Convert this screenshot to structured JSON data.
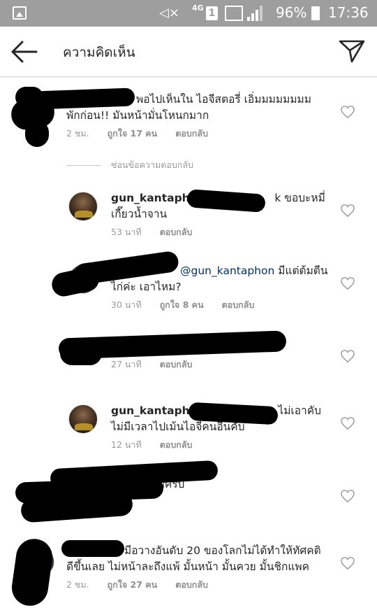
{
  "status_bar": {
    "network": "4G",
    "sim_slot": "1",
    "battery_percent": "96%",
    "time": "17:36"
  },
  "header": {
    "title": "ความคิดเห็น"
  },
  "hide_replies_label": "ซ่อนข้อความตอบกลับ",
  "comments": [
    {
      "text_line1": "พอไปเห็นใน ไอจีสตอรี่ เอิ่มมมมมมมม",
      "text_line2": "พักก่อน!! มันหน้ามั่นโหนกมาก",
      "time": "2 ชม.",
      "likes": "ถูกใจ 17 คน",
      "reply": "ตอบกลับ"
    },
    {
      "username": "gun_kantaphon",
      "text_line1": "k ขอบะหมี่",
      "text_line2": "เกี๊ยวน้ำจาน",
      "time": "53 นาที",
      "reply": "ตอบกลับ"
    },
    {
      "mention": "@gun_kantaphon",
      "text_line1": " มีแต่ต้มตีน",
      "text_line2": "ไก่ค่ะ เอาไหม?",
      "time": "30 นาที",
      "likes": "ถูกใจ 8 คน",
      "reply": "ตอบกลับ"
    },
    {
      "time": "27 นาที",
      "reply": "ตอบกลับ"
    },
    {
      "username": "gun_kantaphon",
      "text_line1": "ไม่เอาคับ",
      "text_line2": "ไม่มีเวลาไปเม้นไอจีคนอื่นคับ",
      "time": "12 นาที",
      "reply": "ตอบกลับ"
    },
    {
      "text_line1": "บครับ"
    },
    {
      "text_line1": "มีอวางอันดับ 20 ของโลกไม่ได้ทำให้ทัศคติ",
      "text_line2": "ดีขึ้นเลย ไม่หน้าละถึงแพ้ มั้นหน้า มั้นควย มั้นชิกแพค",
      "time": "2 ชม.",
      "likes": "ถูกใจ 27 คน",
      "reply": "ตอบกลับ"
    }
  ],
  "colors": {
    "status_bar_bg": "#9e9e9e",
    "mention": "#003569",
    "meta_text": "#999999"
  }
}
